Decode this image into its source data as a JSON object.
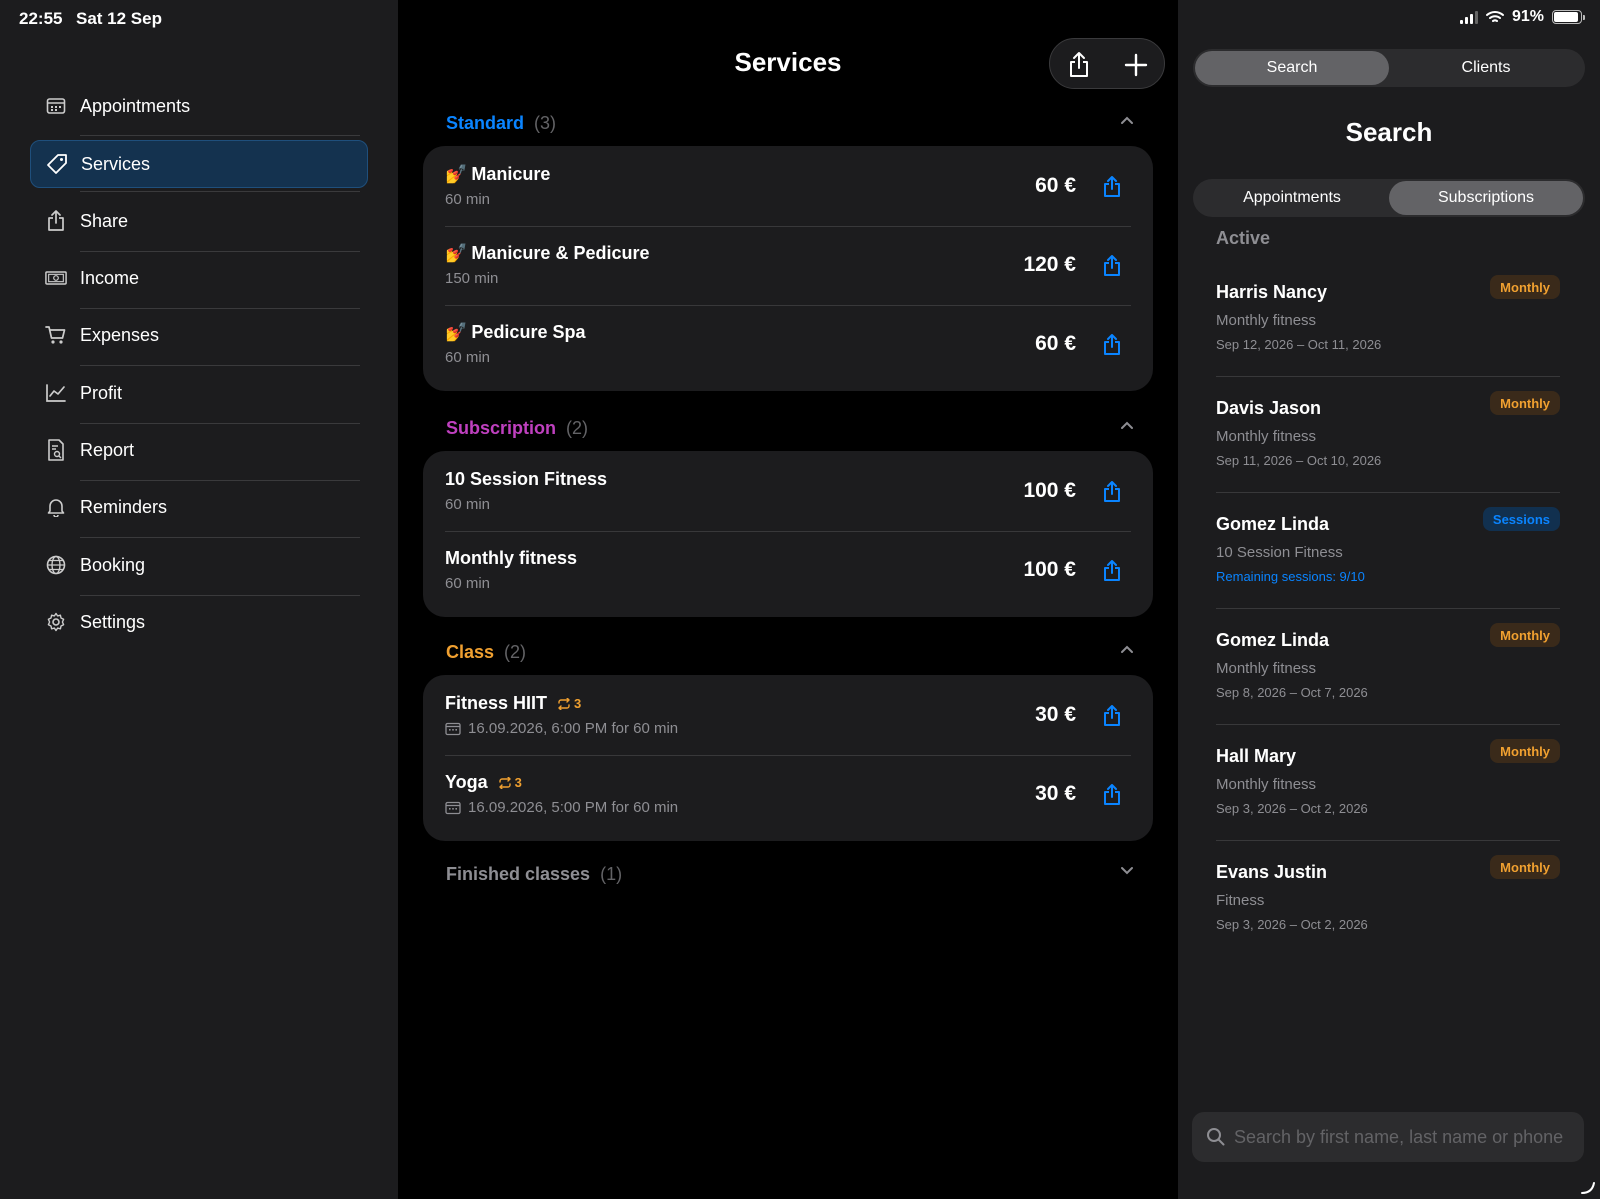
{
  "status": {
    "time": "22:55",
    "date": "Sat 12 Sep",
    "battery": "91%",
    "battery_level": 0.91
  },
  "sidebar": {
    "items": [
      {
        "label": "Appointments",
        "icon": "calendar-icon",
        "active": false
      },
      {
        "label": "Services",
        "icon": "tag-icon",
        "active": true
      },
      {
        "label": "Share",
        "icon": "share-icon",
        "active": false
      },
      {
        "label": "Income",
        "icon": "banknote-icon",
        "active": false
      },
      {
        "label": "Expenses",
        "icon": "cart-icon",
        "active": false
      },
      {
        "label": "Profit",
        "icon": "chart-icon",
        "active": false
      },
      {
        "label": "Report",
        "icon": "report-icon",
        "active": false
      },
      {
        "label": "Reminders",
        "icon": "bell-icon",
        "active": false
      },
      {
        "label": "Booking",
        "icon": "globe-icon",
        "active": false
      },
      {
        "label": "Settings",
        "icon": "gear-icon",
        "active": false
      }
    ]
  },
  "main": {
    "title": "Services",
    "sections": [
      {
        "title": "Standard",
        "count": "(3)",
        "color": "#0a84ff",
        "rows": [
          {
            "name": "Manicure",
            "sub": "60 min",
            "price": "60 €",
            "emoji": "💅"
          },
          {
            "name": "Manicure & Pedicure",
            "sub": "150 min",
            "price": "120 €",
            "emoji": "💅"
          },
          {
            "name": "Pedicure Spa",
            "sub": "60 min",
            "price": "60 €",
            "emoji": "💅"
          }
        ]
      },
      {
        "title": "Subscription",
        "count": "(2)",
        "color": "#bf40bf",
        "rows": [
          {
            "name": "10 Session Fitness",
            "sub": "60 min",
            "price": "100 €"
          },
          {
            "name": "Monthly fitness",
            "sub": "60 min",
            "price": "100 €"
          }
        ]
      },
      {
        "title": "Class",
        "count": "(2)",
        "color": "#f0a030",
        "rows": [
          {
            "name": "Fitness HIIT",
            "repeat": "3",
            "sub": "16.09.2026, 6:00 PM for 60 min",
            "price": "30 €"
          },
          {
            "name": "Yoga",
            "repeat": "3",
            "sub": "16.09.2026, 5:00 PM for 60 min",
            "price": "30 €"
          }
        ]
      }
    ],
    "finished": {
      "title": "Finished classes",
      "count": "(1)"
    }
  },
  "right": {
    "top_tabs": [
      "Search",
      "Clients"
    ],
    "top_tab_selected": "Search",
    "title": "Search",
    "sub_tabs": [
      "Appointments",
      "Subscriptions"
    ],
    "sub_tab_selected": "Subscriptions",
    "active_label": "Active",
    "subscriptions": [
      {
        "name": "Harris Nancy",
        "service": "Monthly fitness",
        "detail": "Sep 12, 2026 – Oct 11, 2026",
        "badge": "Monthly",
        "kind": "monthly"
      },
      {
        "name": "Davis Jason",
        "service": "Monthly fitness",
        "detail": "Sep 11, 2026 – Oct 10, 2026",
        "badge": "Monthly",
        "kind": "monthly"
      },
      {
        "name": "Gomez Linda",
        "service": "10 Session Fitness",
        "detail": "Remaining sessions: 9/10",
        "badge": "Sessions",
        "kind": "sessions"
      },
      {
        "name": "Gomez Linda",
        "service": "Monthly fitness",
        "detail": "Sep 8, 2026 – Oct 7, 2026",
        "badge": "Monthly",
        "kind": "monthly"
      },
      {
        "name": "Hall Mary",
        "service": "Monthly fitness",
        "detail": "Sep 3, 2026 – Oct 2, 2026",
        "badge": "Monthly",
        "kind": "monthly"
      },
      {
        "name": "Evans Justin",
        "service": "Fitness",
        "detail": "Sep 3, 2026 – Oct 2, 2026",
        "badge": "Monthly",
        "kind": "monthly"
      }
    ],
    "search_placeholder": "Search by first name, last name or phone"
  }
}
